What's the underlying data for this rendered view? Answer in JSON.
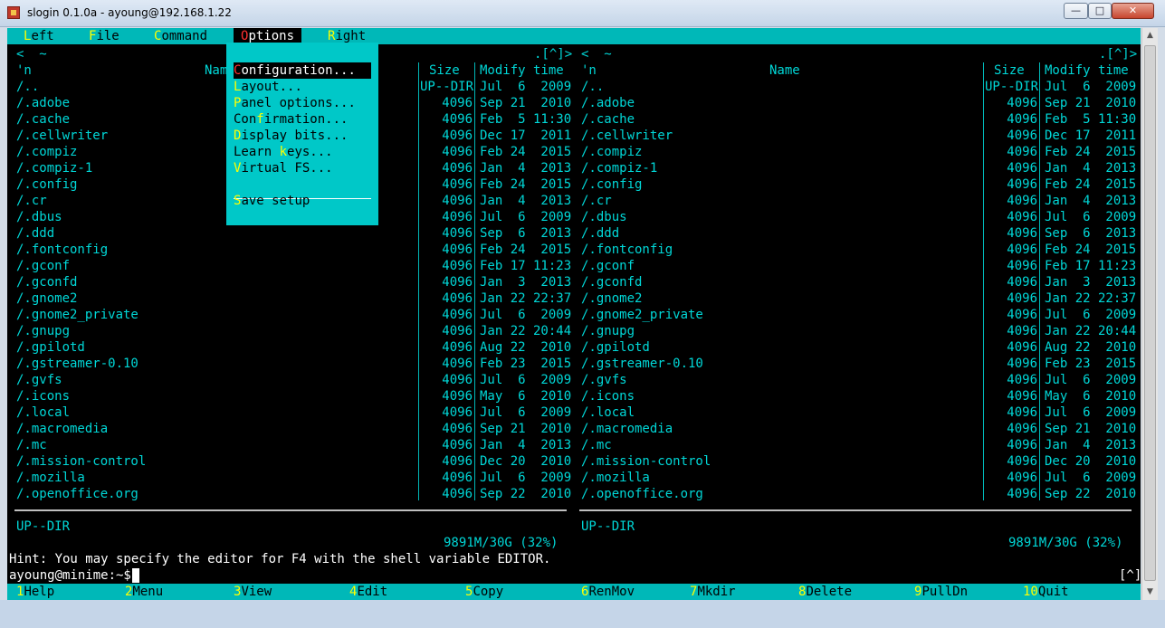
{
  "window": {
    "title": "slogin 0.1.0a - ayoung@192.168.1.22"
  },
  "menubar": {
    "items": [
      {
        "hk": "L",
        "rest": "eft"
      },
      {
        "hk": "F",
        "rest": "ile"
      },
      {
        "hk": "C",
        "rest": "ommand"
      },
      {
        "hk": "O",
        "rest": "ptions",
        "active": true
      },
      {
        "hk": "R",
        "rest": "ight"
      }
    ]
  },
  "options_menu": {
    "items": [
      {
        "hk": "C",
        "rest": "onfiguration...",
        "selected": true
      },
      {
        "hk": "L",
        "rest": "ayout..."
      },
      {
        "hk": "P",
        "rest": "anel options..."
      },
      {
        "hk": "",
        "pre": "Con",
        "mid": "f",
        "rest": "irmation..."
      },
      {
        "hk": "D",
        "rest": "isplay bits..."
      },
      {
        "hk": "",
        "pre": "Learn ",
        "mid": "k",
        "rest": "eys..."
      },
      {
        "hk": "V",
        "rest": "irtual FS..."
      },
      {
        "hk": "S",
        "rest": "ave setup"
      }
    ]
  },
  "panel": {
    "path_left": "<  ~",
    "path_right": ".[^]>",
    "headers": {
      "n": "'n",
      "name": "Name",
      "size": "Size",
      "mtime": "Modify time"
    },
    "rows": [
      {
        "name": "/..",
        "size": "UP--DIR",
        "date": "Jul  6  2009"
      },
      {
        "name": "/.adobe",
        "size": "4096",
        "date": "Sep 21  2010"
      },
      {
        "name": "/.cache",
        "size": "4096",
        "date": "Feb  5 11:30"
      },
      {
        "name": "/.cellwriter",
        "size": "4096",
        "date": "Dec 17  2011"
      },
      {
        "name": "/.compiz",
        "size": "4096",
        "date": "Feb 24  2015"
      },
      {
        "name": "/.compiz-1",
        "size": "4096",
        "date": "Jan  4  2013"
      },
      {
        "name": "/.config",
        "size": "4096",
        "date": "Feb 24  2015"
      },
      {
        "name": "/.cr",
        "size": "4096",
        "date": "Jan  4  2013"
      },
      {
        "name": "/.dbus",
        "size": "4096",
        "date": "Jul  6  2009"
      },
      {
        "name": "/.ddd",
        "size": "4096",
        "date": "Sep  6  2013"
      },
      {
        "name": "/.fontconfig",
        "size": "4096",
        "date": "Feb 24  2015"
      },
      {
        "name": "/.gconf",
        "size": "4096",
        "date": "Feb 17 11:23"
      },
      {
        "name": "/.gconfd",
        "size": "4096",
        "date": "Jan  3  2013"
      },
      {
        "name": "/.gnome2",
        "size": "4096",
        "date": "Jan 22 22:37"
      },
      {
        "name": "/.gnome2_private",
        "size": "4096",
        "date": "Jul  6  2009"
      },
      {
        "name": "/.gnupg",
        "size": "4096",
        "date": "Jan 22 20:44"
      },
      {
        "name": "/.gpilotd",
        "size": "4096",
        "date": "Aug 22  2010"
      },
      {
        "name": "/.gstreamer-0.10",
        "size": "4096",
        "date": "Feb 23  2015"
      },
      {
        "name": "/.gvfs",
        "size": "4096",
        "date": "Jul  6  2009"
      },
      {
        "name": "/.icons",
        "size": "4096",
        "date": "May  6  2010"
      },
      {
        "name": "/.local",
        "size": "4096",
        "date": "Jul  6  2009"
      },
      {
        "name": "/.macromedia",
        "size": "4096",
        "date": "Sep 21  2010"
      },
      {
        "name": "/.mc",
        "size": "4096",
        "date": "Jan  4  2013"
      },
      {
        "name": "/.mission-control",
        "size": "4096",
        "date": "Dec 20  2010"
      },
      {
        "name": "/.mozilla",
        "size": "4096",
        "date": "Jul  6  2009"
      },
      {
        "name": "/.openoffice.org",
        "size": "4096",
        "date": "Sep 22  2010"
      }
    ],
    "status": "UP--DIR",
    "free": "9891M/30G (32%)"
  },
  "hint": "Hint: You may specify the editor for F4 with the shell variable EDITOR.",
  "prompt": "ayoung@minime:~$",
  "prompt_right": "[^]",
  "fkeys": [
    {
      "num": "1",
      "label": "Help"
    },
    {
      "num": "2",
      "label": "Menu"
    },
    {
      "num": "3",
      "label": "View"
    },
    {
      "num": "4",
      "label": "Edit"
    },
    {
      "num": "5",
      "label": "Copy"
    },
    {
      "num": "6",
      "label": "RenMov"
    },
    {
      "num": "7",
      "label": "Mkdir"
    },
    {
      "num": "8",
      "label": "Delete"
    },
    {
      "num": "9",
      "label": "PullDn"
    },
    {
      "num": "10",
      "label": "Quit"
    }
  ],
  "colors": {
    "cyan": "#00d7d7",
    "menubar": "#00b8b8",
    "hotkey": "#ffff00",
    "active_hotkey": "#ff3030"
  }
}
